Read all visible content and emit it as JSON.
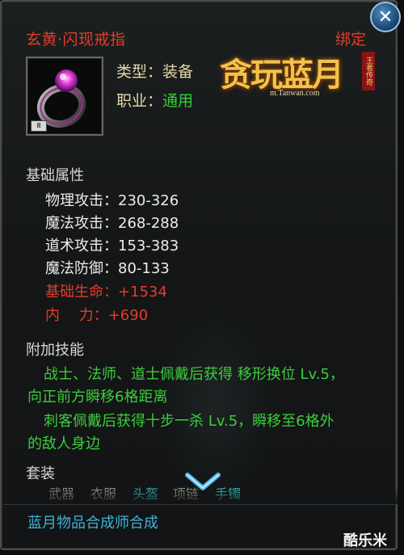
{
  "item": {
    "name": "玄黄·闪现戒指",
    "bind_status": "绑定",
    "type_label": "类型：",
    "type_value": "装备",
    "class_label": "职业：",
    "class_value": "通用",
    "icon": "ring-icon"
  },
  "logo": {
    "main": "贪玩蓝月",
    "side": "王者传奇",
    "url": "m.Tanwan.com"
  },
  "base_attributes": {
    "title": "基础属性",
    "rows": [
      {
        "text": "物理攻击：230-326"
      },
      {
        "text": "魔法攻击：268-288"
      },
      {
        "text": "道术攻击：153-383"
      },
      {
        "text": "魔法防御：80-133"
      },
      {
        "text": "基础生命：+1534"
      },
      {
        "text": "内　 力：+690"
      }
    ]
  },
  "extra_skill": {
    "title": "附加技能",
    "lines": [
      "战士、法师、道士佩戴后获得 移形换位 Lv.5，",
      "向正前方瞬移6格距离",
      "刺客佩戴后获得十步一杀 Lv.5，瞬移至6格外",
      "的敌人身边"
    ]
  },
  "set": {
    "title": "套装",
    "items": [
      "武器",
      "衣服",
      "头盔",
      "项链",
      "手镯"
    ]
  },
  "footer": "蓝月物品合成师合成",
  "close_icon": "close-icon",
  "scroll_icon": "chevron-down-icon",
  "watermark": "酷乐米",
  "colors": {
    "red": "#e23d2a",
    "green": "#3ccd3c",
    "cyan": "#3fc7c7",
    "footer_blue": "#3fb3d8",
    "gold": "#e4d7a8"
  }
}
